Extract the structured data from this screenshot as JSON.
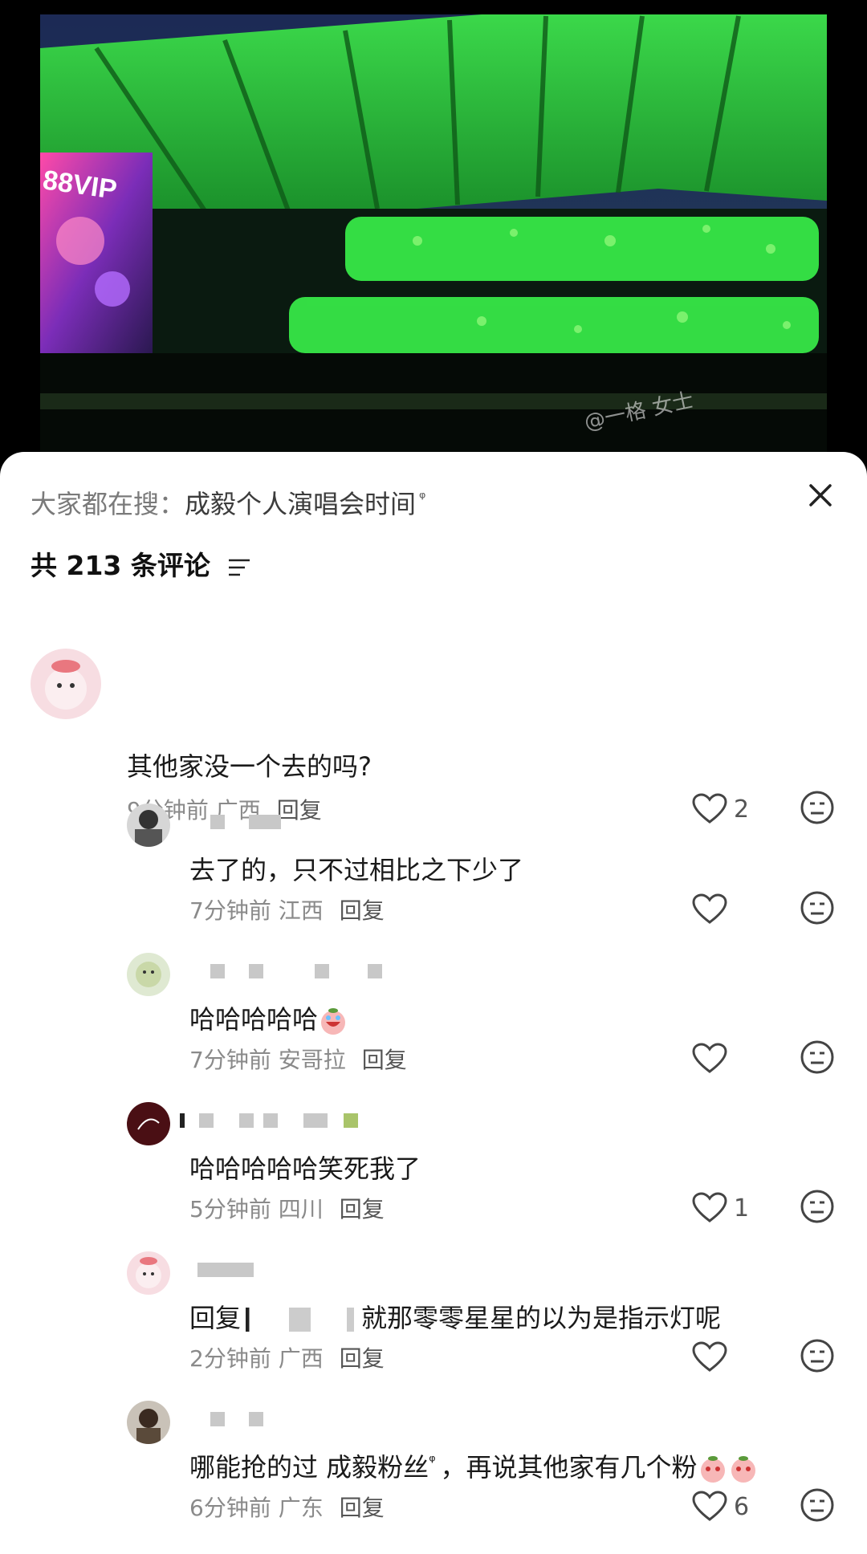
{
  "photo": {
    "banner_text": "88VIP",
    "watermark": "@一格 女士"
  },
  "search": {
    "prefix": "大家都在搜：",
    "term": "成毅个人演唱会时间",
    "search_glyph": "ᵠ"
  },
  "comments_header": {
    "count_label": "共 213 条评论"
  },
  "colors": {
    "accent_green": "#2bdc3a",
    "text_gray": "#8a8a8a"
  },
  "comments": [
    {
      "text": "其他家没一个去的吗?",
      "time": "9分钟前",
      "region": "广西",
      "reply": "回复",
      "likes": "2"
    },
    {
      "text": "去了的，只不过相比之下少了",
      "time": "7分钟前",
      "region": "江西",
      "reply": "回复",
      "likes": ""
    },
    {
      "text": "哈哈哈哈哈",
      "time": "7分钟前",
      "region": "安哥拉",
      "reply": "回复",
      "likes": ""
    },
    {
      "text": "哈哈哈哈哈笑死我了",
      "time": "5分钟前",
      "region": "四川",
      "reply": "回复",
      "likes": "1"
    },
    {
      "text_prefix": "回复",
      "text": "就那零零星星的以为是指示灯呢",
      "time": "2分钟前",
      "region": "广西",
      "reply": "回复",
      "likes": ""
    },
    {
      "text": "哪能抢的过 成毅粉丝",
      "text_suffix": "，再说其他家有几个粉",
      "time": "6分钟前",
      "region": "广东",
      "reply": "回复",
      "likes": "6"
    }
  ]
}
